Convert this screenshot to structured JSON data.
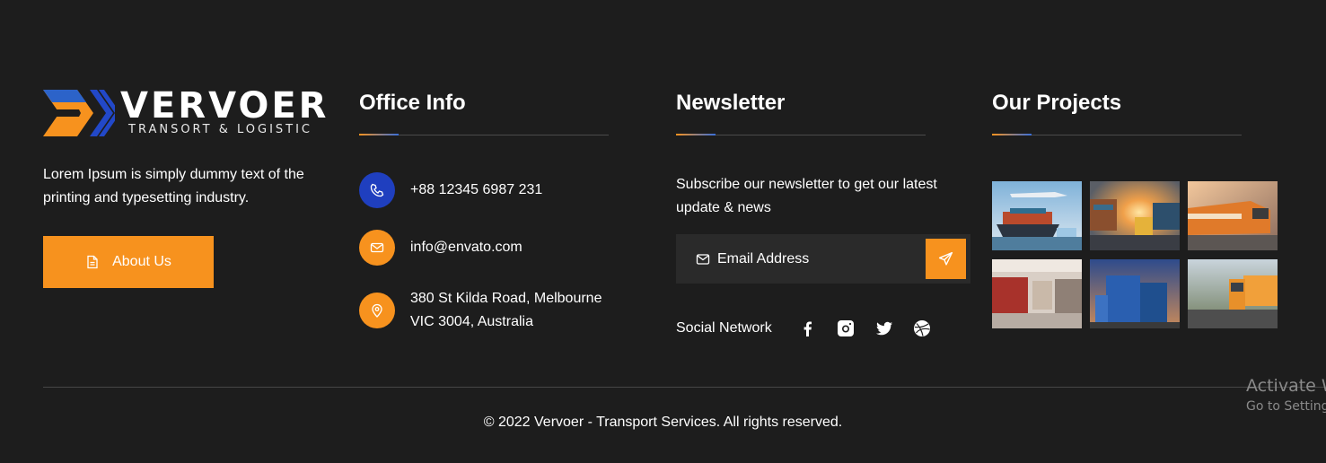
{
  "brand": {
    "name": "VERVOER",
    "tagline": "TRANSORT & LOGISTIC",
    "description": "Lorem Ipsum is simply dummy text of the printing and typesetting industry.",
    "about_label": "About Us"
  },
  "office": {
    "heading": "Office Info",
    "phone": "+88 12345 6987 231",
    "email": "info@envato.com",
    "address_line1": "380 St Kilda Road, Melbourne",
    "address_line2": "VIC 3004, Australia"
  },
  "newsletter": {
    "heading": "Newsletter",
    "description": "Subscribe our newsletter to get our latest update & news",
    "email_placeholder": "Email Address",
    "social_label": "Social Network",
    "social_icons": [
      "facebook-icon",
      "instagram-icon",
      "twitter-icon",
      "dribbble-icon"
    ]
  },
  "projects": {
    "heading": "Our Projects",
    "items": [
      "cargo-ship",
      "container-port-truck",
      "train",
      "workshop",
      "container-yard",
      "truck"
    ]
  },
  "footer": {
    "copyright": "© 2022 Vervoer - Transport Services. All rights reserved."
  },
  "overlay": {
    "activate_title": "Activate W",
    "activate_sub": "Go to Setting"
  },
  "colors": {
    "background": "#1d1d1d",
    "accent": "#f7921e",
    "blue": "#1f3fbf"
  }
}
